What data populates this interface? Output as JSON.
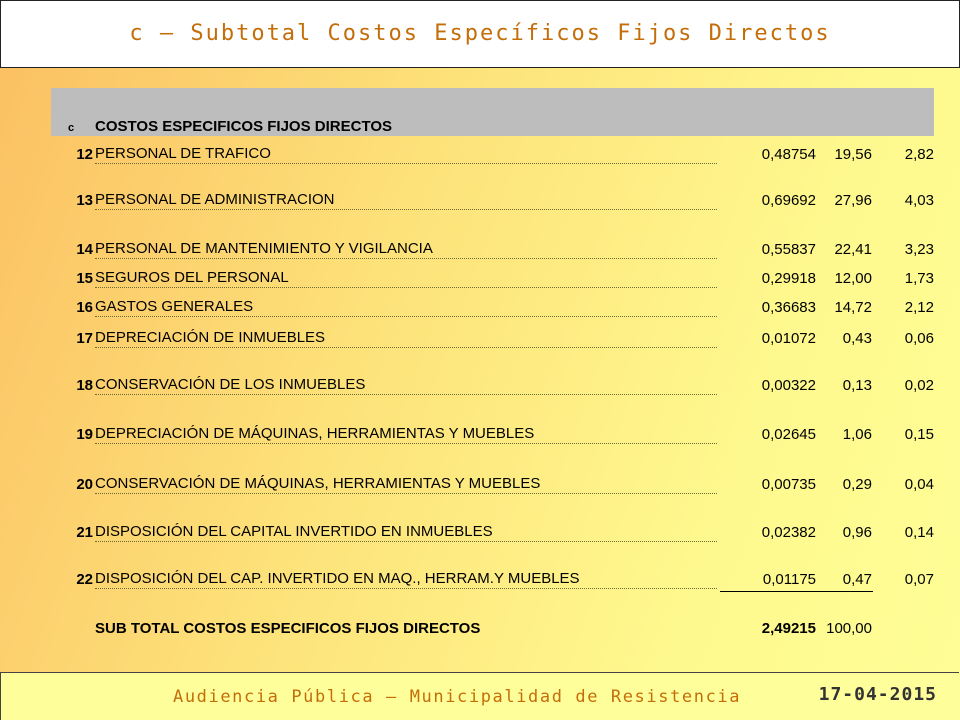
{
  "slide": {
    "title": "c – Subtotal Costos Específicos Fijos Directos"
  },
  "table": {
    "header": {
      "code": "c",
      "label": "COSTOS ESPECIFICOS FIJOS DIRECTOS"
    },
    "rows": [
      {
        "num": "12",
        "desc": "PERSONAL DE TRAFICO",
        "v1": "0,48754",
        "v2": "19,56",
        "v3": "2,82"
      },
      {
        "num": "13",
        "desc": "PERSONAL DE ADMINISTRACION",
        "v1": "0,69692",
        "v2": "27,96",
        "v3": "4,03"
      },
      {
        "num": "14",
        "desc": "PERSONAL DE MANTENIMIENTO Y VIGILANCIA",
        "v1": "0,55837",
        "v2": "22,41",
        "v3": "3,23"
      },
      {
        "num": "15",
        "desc": "SEGUROS DEL PERSONAL",
        "v1": "0,29918",
        "v2": "12,00",
        "v3": "1,73"
      },
      {
        "num": "16",
        "desc": "GASTOS GENERALES",
        "v1": "0,36683",
        "v2": "14,72",
        "v3": "2,12"
      },
      {
        "num": "17",
        "desc": "DEPRECIACIÓN DE INMUEBLES",
        "v1": "0,01072",
        "v2": "0,43",
        "v3": "0,06"
      },
      {
        "num": "18",
        "desc": "CONSERVACIÓN DE LOS INMUEBLES",
        "v1": "0,00322",
        "v2": "0,13",
        "v3": "0,02"
      },
      {
        "num": "19",
        "desc": "DEPRECIACIÓN DE MÁQUINAS, HERRAMIENTAS Y MUEBLES",
        "v1": "0,02645",
        "v2": "1,06",
        "v3": "0,15"
      },
      {
        "num": "20",
        "desc": "CONSERVACIÓN DE MÁQUINAS, HERRAMIENTAS Y MUEBLES",
        "v1": "0,00735",
        "v2": "0,29",
        "v3": "0,04"
      },
      {
        "num": "21",
        "desc": "DISPOSICIÓN DEL CAPITAL INVERTIDO EN INMUEBLES",
        "v1": "0,02382",
        "v2": "0,96",
        "v3": "0,14"
      },
      {
        "num": "22",
        "desc": "DISPOSICIÓN DEL CAP. INVERTIDO EN MAQ., HERRAM.Y MUEBLES",
        "v1": "0,01175",
        "v2": "0,47",
        "v3": "0,07"
      }
    ],
    "subtotal": {
      "desc": "SUB TOTAL COSTOS ESPECIFICOS FIJOS DIRECTOS",
      "v1": "2,49215",
      "v2": "100,00"
    }
  },
  "footer": {
    "text": "Audiencia Pública – Municipalidad de Resistencia",
    "date": "17-04-2015"
  }
}
